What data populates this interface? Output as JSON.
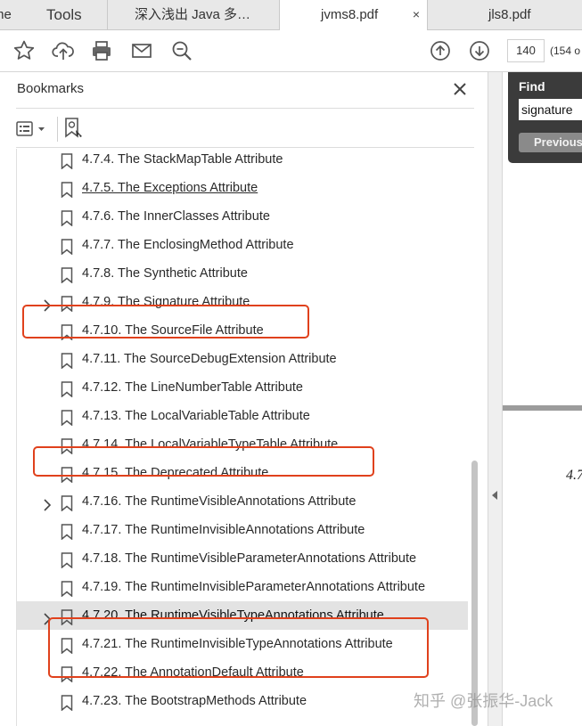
{
  "tabs": {
    "home": "me",
    "tools": "Tools",
    "doc1": "深入浅出 Java 多…",
    "doc2": "jvms8.pdf",
    "doc2_close": "×",
    "doc3": "jls8.pdf"
  },
  "toolbar": {
    "page_number": "140",
    "page_count": "(154 o"
  },
  "bookmarks": {
    "title": "Bookmarks",
    "items": [
      {
        "label": "4.7.4. The StackMapTable Attribute",
        "expandable": false
      },
      {
        "label": "4.7.5. The Exceptions Attribute",
        "expandable": false,
        "link": true
      },
      {
        "label": "4.7.6. The InnerClasses Attribute",
        "expandable": false
      },
      {
        "label": "4.7.7. The EnclosingMethod Attribute",
        "expandable": false
      },
      {
        "label": "4.7.8. The Synthetic Attribute",
        "expandable": false
      },
      {
        "label": "4.7.9. The Signature Attribute",
        "expandable": true,
        "highlighted": true
      },
      {
        "label": "4.7.10. The SourceFile Attribute",
        "expandable": false
      },
      {
        "label": "4.7.11. The SourceDebugExtension Attribute",
        "expandable": false
      },
      {
        "label": "4.7.12. The LineNumberTable Attribute",
        "expandable": false
      },
      {
        "label": "4.7.13. The LocalVariableTable Attribute",
        "expandable": false
      },
      {
        "label": "4.7.14. The LocalVariableTypeTable Attribute",
        "expandable": false,
        "highlighted": true
      },
      {
        "label": "4.7.15. The Deprecated Attribute",
        "expandable": false
      },
      {
        "label": "4.7.16. The RuntimeVisibleAnnotations Attribute",
        "expandable": true
      },
      {
        "label": "4.7.17. The RuntimeInvisibleAnnotations Attribute",
        "expandable": false
      },
      {
        "label": "4.7.18. The RuntimeVisibleParameterAnnotations Attribute",
        "expandable": false
      },
      {
        "label": "4.7.19. The RuntimeInvisibleParameterAnnotations Attribute",
        "expandable": false
      },
      {
        "label": "4.7.20. The RuntimeVisibleTypeAnnotations Attribute",
        "expandable": true,
        "selected": true,
        "highlighted": true
      },
      {
        "label": "4.7.21. The RuntimeInvisibleTypeAnnotations Attribute",
        "expandable": false,
        "highlighted": true
      },
      {
        "label": "4.7.22. The AnnotationDefault Attribute",
        "expandable": false
      },
      {
        "label": "4.7.23. The BootstrapMethods Attribute",
        "expandable": false
      }
    ]
  },
  "find": {
    "title": "Find",
    "query": "signature",
    "previous_label": "Previous"
  },
  "document": {
    "visible_text": "4.7"
  },
  "watermark": "知乎 @张振华-Jack",
  "colors": {
    "highlight_box": "#e0411c",
    "selected_row": "#e3e3e3",
    "find_panel": "#3b3b3b"
  }
}
